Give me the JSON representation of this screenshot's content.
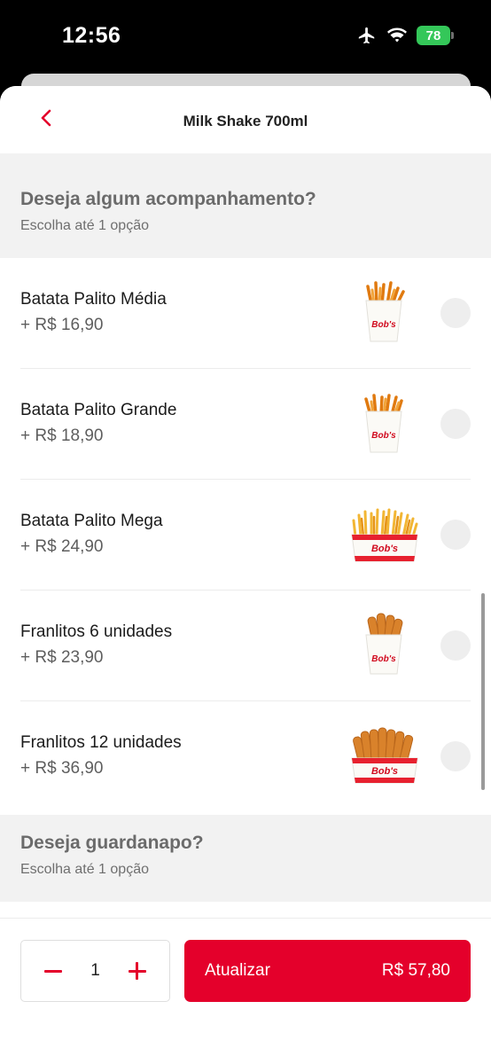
{
  "status_bar": {
    "time": "12:56",
    "battery": "78"
  },
  "header": {
    "title": "Milk Shake 700ml"
  },
  "section_sides": {
    "title": "Deseja algum acompanhamento?",
    "subtitle": "Escolha até 1 opção",
    "options": [
      {
        "name": "Batata Palito Média",
        "price": "+ R$ 16,90",
        "image": "fries-medium-image"
      },
      {
        "name": "Batata Palito Grande",
        "price": "+ R$ 18,90",
        "image": "fries-large-image"
      },
      {
        "name": "Batata Palito Mega",
        "price": "+ R$ 24,90",
        "image": "fries-mega-image"
      },
      {
        "name": "Franlitos 6 unidades",
        "price": "+ R$ 23,90",
        "image": "franlitos-6-image"
      },
      {
        "name": "Franlitos 12 unidades",
        "price": "+ R$ 36,90",
        "image": "franlitos-12-image"
      }
    ]
  },
  "section_napkin": {
    "title": "Deseja guardanapo?",
    "subtitle": "Escolha até 1 opção"
  },
  "footer": {
    "quantity": "1",
    "button_label": "Atualizar",
    "button_total": "R$ 57,80"
  },
  "colors": {
    "brand": "#e4002b",
    "section_bg": "#f2f2f2",
    "battery": "#34c759"
  },
  "icons": [
    "airplane-icon",
    "wifi-icon",
    "battery-icon",
    "chevron-left-icon",
    "minus-icon",
    "plus-icon"
  ]
}
